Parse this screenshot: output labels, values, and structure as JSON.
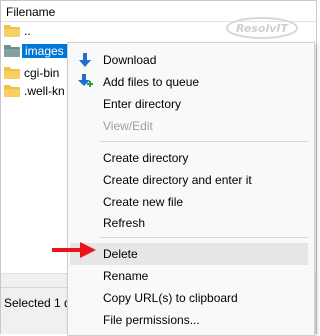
{
  "header": {
    "column_label": "Filename"
  },
  "logo": {
    "text": "ResolvIT"
  },
  "files": [
    {
      "name": "..",
      "selected": false
    },
    {
      "name": "images",
      "selected": true
    },
    {
      "name": "cgi-bin",
      "selected": false
    },
    {
      "name": ".well-kn",
      "selected": false
    }
  ],
  "status": {
    "text": "Selected 1 d"
  },
  "context_menu": {
    "download": "Download",
    "add_to_queue": "Add files to queue",
    "enter_directory": "Enter directory",
    "view_edit": "View/Edit",
    "create_directory": "Create directory",
    "create_directory_enter": "Create directory and enter it",
    "create_new_file": "Create new file",
    "refresh": "Refresh",
    "delete": "Delete",
    "rename": "Rename",
    "copy_urls": "Copy URL(s) to clipboard",
    "file_permissions": "File permissions..."
  },
  "colors": {
    "selection": "#0078d7",
    "folder": "#f4c04a",
    "annotation_arrow": "#e8141b",
    "menu_hover": "#e6e6e6"
  }
}
